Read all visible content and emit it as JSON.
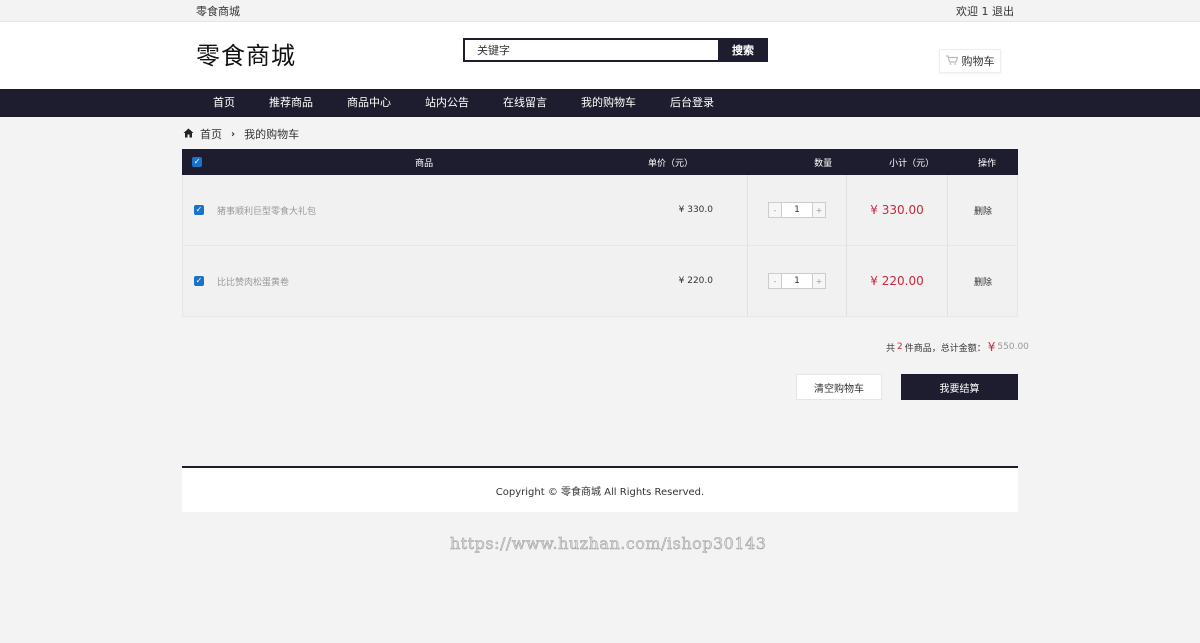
{
  "topbar": {
    "welcome": "欢迎 1",
    "logout": "退出"
  },
  "brand": {
    "name": "零食商城"
  },
  "search": {
    "placeholder": "关键字",
    "button": "搜索"
  },
  "cart_button": {
    "icon": "cart-icon",
    "label": "购物车"
  },
  "nav": {
    "items": [
      "首页",
      "推荐商品",
      "商品中心",
      "站内公告",
      "在线留言",
      "我的购物车",
      "后台登录"
    ]
  },
  "breadcrumb": {
    "home": "首页",
    "current": "我的购物车"
  },
  "cart_table": {
    "headers": {
      "product": "商品",
      "price": "单价（元）",
      "quantity": "数量",
      "subtotal": "小计（元）",
      "action": "操作"
    },
    "rows": [
      {
        "checked": true,
        "name": "猪事顺利巨型零食大礼包",
        "price": "¥ 330.0",
        "quantity": "1",
        "subtotal": "¥ 330.00",
        "action": "删除"
      },
      {
        "checked": true,
        "name": "比比赞肉松蛋黄卷",
        "price": "¥ 220.0",
        "quantity": "1",
        "subtotal": "¥ 220.00",
        "action": "删除"
      }
    ],
    "stepper": {
      "minus": "-",
      "plus": "+"
    }
  },
  "summary": {
    "prefix": "共",
    "count": "2",
    "middle": "件商品，总计金额：",
    "currency": "¥",
    "amount": "550.00"
  },
  "actions": {
    "clear": "清空购物车",
    "checkout": "我要结算"
  },
  "footer": {
    "copyright": "Copyright © 零食商城 All Rights Reserved."
  },
  "watermark": {
    "text": "https://www.huzhan.com/ishop30143"
  },
  "colors": {
    "dark": "#1e1d2f",
    "price_red": "#c8283e",
    "checkbox_blue": "#1a73c8"
  }
}
